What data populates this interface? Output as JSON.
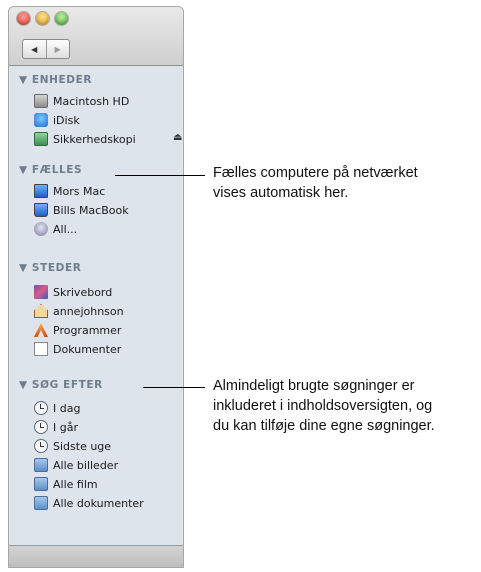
{
  "window": {
    "controls": [
      "close-button",
      "minimize-button",
      "zoom-button"
    ]
  },
  "nav": {
    "back_icon": "◀",
    "forward_icon": "▶"
  },
  "sections": {
    "enheder": {
      "title": "▼ ENHEDER",
      "items": [
        "Macintosh HD",
        "iDisk",
        "Sikkerhedskopi"
      ],
      "eject_icon": "⏏"
    },
    "faelles": {
      "title": "▼ FÆLLES",
      "items": [
        "Mors Mac",
        "Bills MacBook",
        "All..."
      ]
    },
    "steder": {
      "title": "▼ STEDER",
      "items": [
        "Skrivebord",
        "annejohnson",
        "Programmer",
        "Dokumenter"
      ]
    },
    "soeg": {
      "title": "▼ SØG EFTER",
      "items": [
        "I dag",
        "I går",
        "Sidste uge",
        "Alle billeder",
        "Alle film",
        "Alle dokumenter"
      ]
    }
  },
  "callouts": {
    "shared": {
      "line1": "Fælles computere på netværket",
      "line2": "vises automatisk her."
    },
    "searches": {
      "line1": "Almindeligt brugte søgninger er",
      "line2": "inkluderet i indholdsoversigten, og",
      "line3": "du kan tilføje dine egne søgninger."
    }
  }
}
